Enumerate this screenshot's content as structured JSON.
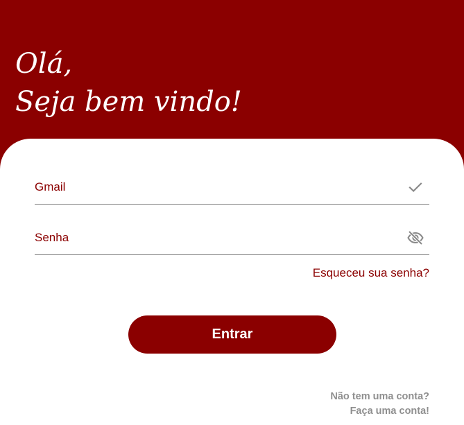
{
  "header": {
    "greeting_line1": "Olá,",
    "greeting_line2": "Seja bem vindo!"
  },
  "form": {
    "email": {
      "label": "Gmail",
      "icon": "check-icon"
    },
    "password": {
      "label": "Senha",
      "icon": "eye-off-icon"
    },
    "forgot_password": "Esqueceu sua senha?",
    "submit_label": "Entrar"
  },
  "footer": {
    "question": "Não tem uma conta?",
    "signup_link": "Faça uma conta!"
  },
  "colors": {
    "brand": "#8b0000",
    "background_card": "#ffffff",
    "muted_text": "#8f8f8f",
    "icon_gray": "#8a8a8a"
  }
}
